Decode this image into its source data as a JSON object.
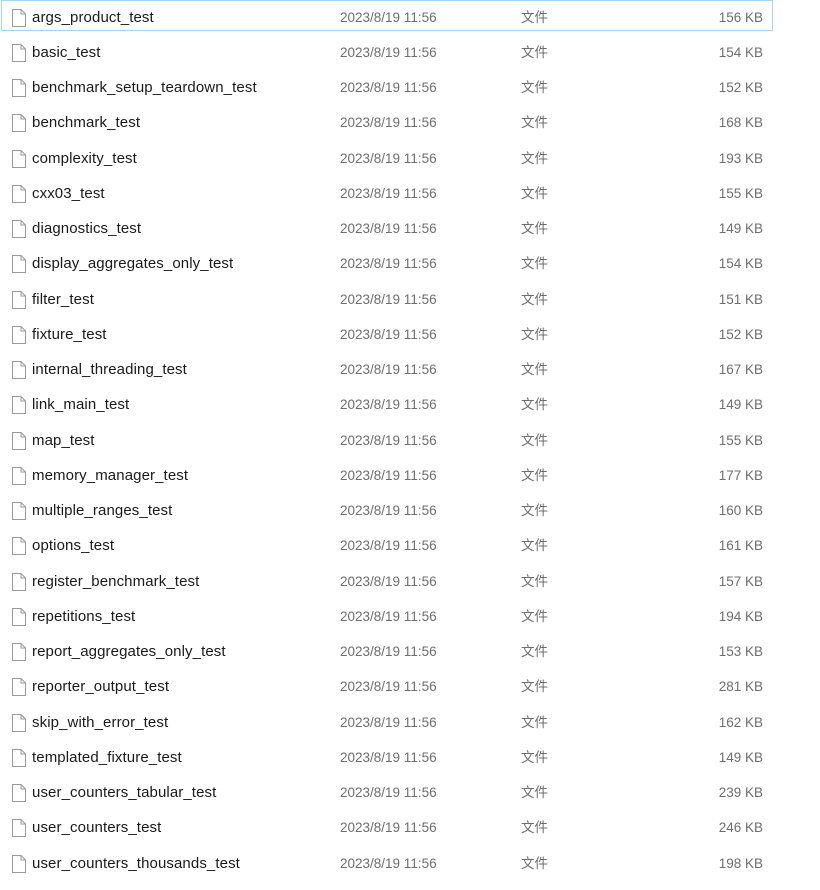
{
  "view": {
    "kind": "file-explorer-details-list",
    "icon_name": "document-file-icon",
    "focused_row_index": 0,
    "colors": {
      "focus_border": "#a6d5f2",
      "row_background": "#ffffff",
      "name_text": "#1a1a1a",
      "meta_text": "#6e6e6e",
      "icon_outline": "#9a9a9a"
    }
  },
  "columns": {
    "name": "",
    "date_modified": "",
    "type": "",
    "size": ""
  },
  "files": [
    {
      "name": "args_product_test",
      "date": "2023/8/19 11:56",
      "type": "文件",
      "size": "156 KB"
    },
    {
      "name": "basic_test",
      "date": "2023/8/19 11:56",
      "type": "文件",
      "size": "154 KB"
    },
    {
      "name": "benchmark_setup_teardown_test",
      "date": "2023/8/19 11:56",
      "type": "文件",
      "size": "152 KB"
    },
    {
      "name": "benchmark_test",
      "date": "2023/8/19 11:56",
      "type": "文件",
      "size": "168 KB"
    },
    {
      "name": "complexity_test",
      "date": "2023/8/19 11:56",
      "type": "文件",
      "size": "193 KB"
    },
    {
      "name": "cxx03_test",
      "date": "2023/8/19 11:56",
      "type": "文件",
      "size": "155 KB"
    },
    {
      "name": "diagnostics_test",
      "date": "2023/8/19 11:56",
      "type": "文件",
      "size": "149 KB"
    },
    {
      "name": "display_aggregates_only_test",
      "date": "2023/8/19 11:56",
      "type": "文件",
      "size": "154 KB"
    },
    {
      "name": "filter_test",
      "date": "2023/8/19 11:56",
      "type": "文件",
      "size": "151 KB"
    },
    {
      "name": "fixture_test",
      "date": "2023/8/19 11:56",
      "type": "文件",
      "size": "152 KB"
    },
    {
      "name": "internal_threading_test",
      "date": "2023/8/19 11:56",
      "type": "文件",
      "size": "167 KB"
    },
    {
      "name": "link_main_test",
      "date": "2023/8/19 11:56",
      "type": "文件",
      "size": "149 KB"
    },
    {
      "name": "map_test",
      "date": "2023/8/19 11:56",
      "type": "文件",
      "size": "155 KB"
    },
    {
      "name": "memory_manager_test",
      "date": "2023/8/19 11:56",
      "type": "文件",
      "size": "177 KB"
    },
    {
      "name": "multiple_ranges_test",
      "date": "2023/8/19 11:56",
      "type": "文件",
      "size": "160 KB"
    },
    {
      "name": "options_test",
      "date": "2023/8/19 11:56",
      "type": "文件",
      "size": "161 KB"
    },
    {
      "name": "register_benchmark_test",
      "date": "2023/8/19 11:56",
      "type": "文件",
      "size": "157 KB"
    },
    {
      "name": "repetitions_test",
      "date": "2023/8/19 11:56",
      "type": "文件",
      "size": "194 KB"
    },
    {
      "name": "report_aggregates_only_test",
      "date": "2023/8/19 11:56",
      "type": "文件",
      "size": "153 KB"
    },
    {
      "name": "reporter_output_test",
      "date": "2023/8/19 11:56",
      "type": "文件",
      "size": "281 KB"
    },
    {
      "name": "skip_with_error_test",
      "date": "2023/8/19 11:56",
      "type": "文件",
      "size": "162 KB"
    },
    {
      "name": "templated_fixture_test",
      "date": "2023/8/19 11:56",
      "type": "文件",
      "size": "149 KB"
    },
    {
      "name": "user_counters_tabular_test",
      "date": "2023/8/19 11:56",
      "type": "文件",
      "size": "239 KB"
    },
    {
      "name": "user_counters_test",
      "date": "2023/8/19 11:56",
      "type": "文件",
      "size": "246 KB"
    },
    {
      "name": "user_counters_thousands_test",
      "date": "2023/8/19 11:56",
      "type": "文件",
      "size": "198 KB"
    }
  ]
}
